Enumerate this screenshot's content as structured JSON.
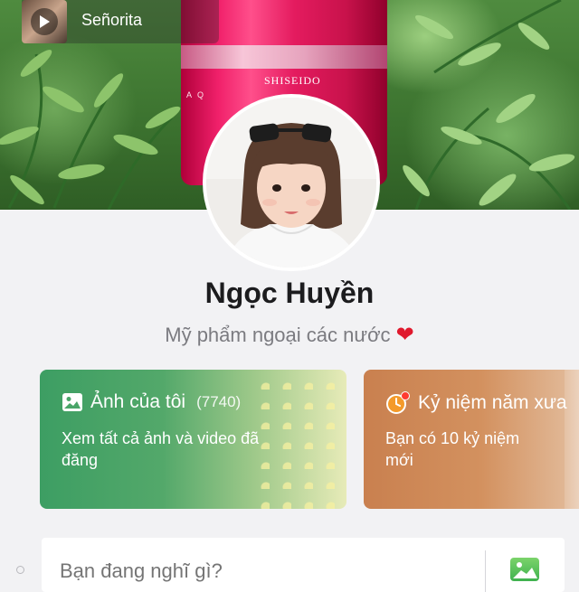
{
  "music": {
    "title": "Señorita",
    "icon": "play-icon"
  },
  "cover": {
    "brand": "SHISEIDO",
    "sub": "A Q"
  },
  "profile": {
    "name": "Ngọc Huyền",
    "bio": "Mỹ phẩm ngoại các nước",
    "bio_icon": "heart-icon",
    "heart": "❤"
  },
  "cards": [
    {
      "icon": "photo-icon",
      "title": "Ảnh của tôi",
      "count": "(7740)",
      "description": "Xem tất cả ảnh và video đã đăng",
      "color": "#3d9e63"
    },
    {
      "icon": "clock-icon",
      "title": "Kỷ niệm năm xưa",
      "description": "Bạn có 10 kỷ niệm mới",
      "color": "#c9804f"
    }
  ],
  "composer": {
    "placeholder": "Bạn đang nghĩ gì?",
    "photo_icon": "image-icon"
  },
  "colors": {
    "background": "#f2f2f4",
    "heart": "#e0192d",
    "alert_dot": "#ff3b30"
  }
}
